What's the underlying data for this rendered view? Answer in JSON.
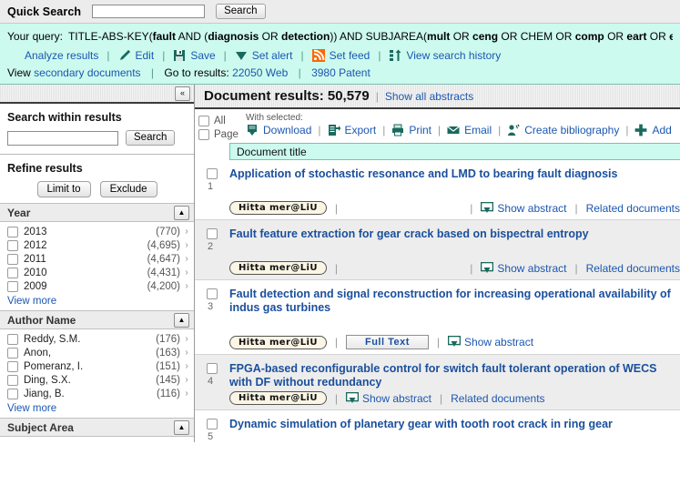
{
  "quick_search": {
    "label": "Quick Search",
    "input_value": "",
    "input_placeholder": "",
    "button_label": "Search"
  },
  "query": {
    "label": "Your query:",
    "parts": [
      {
        "text": "TITLE-ABS-KEY(",
        "bold": false
      },
      {
        "text": "fault",
        "bold": true
      },
      {
        "text": " AND (",
        "bold": false
      },
      {
        "text": "diagnosis",
        "bold": true
      },
      {
        "text": " OR ",
        "bold": false
      },
      {
        "text": "detection",
        "bold": true
      },
      {
        "text": ")) AND SUBJAREA(",
        "bold": false
      },
      {
        "text": "mult",
        "bold": true
      },
      {
        "text": " OR ",
        "bold": false
      },
      {
        "text": "ceng",
        "bold": true
      },
      {
        "text": " OR CHEM OR ",
        "bold": false
      },
      {
        "text": "comp",
        "bold": true
      },
      {
        "text": " OR ",
        "bold": false
      },
      {
        "text": "eart",
        "bold": true
      },
      {
        "text": " OR ",
        "bold": false
      },
      {
        "text": "en",
        "bold": true
      }
    ],
    "actions": [
      {
        "label": "Analyze results",
        "icon": "bar-chart-icon"
      },
      {
        "label": "Edit",
        "icon": "pencil-icon"
      },
      {
        "label": "Save",
        "icon": "floppy-disk-icon"
      },
      {
        "label": "Set alert",
        "icon": "alert-tag-icon"
      },
      {
        "label": "Set feed",
        "icon": "rss-feed-icon"
      },
      {
        "label": "View search history",
        "icon": "search-history-icon"
      }
    ],
    "separator": "|",
    "secondary": {
      "view_label": "View",
      "secondary_link": "secondary documents",
      "goto_label": "Go to results:",
      "web_count": "22050",
      "web_label": "Web",
      "patent_count": "3980",
      "patent_label": "Patent"
    }
  },
  "sidebar": {
    "collapse_icon": "«",
    "search_within": {
      "heading": "Search within results",
      "input_value": "",
      "button_label": "Search"
    },
    "refine": {
      "heading": "Refine results",
      "limit_label": "Limit to",
      "exclude_label": "Exclude"
    },
    "facets": [
      {
        "title": "Year",
        "toggle_icon": "▲",
        "rows": [
          {
            "name": "2013",
            "count": "(770)"
          },
          {
            "name": "2012",
            "count": "(4,695)"
          },
          {
            "name": "2011",
            "count": "(4,647)"
          },
          {
            "name": "2010",
            "count": "(4,431)"
          },
          {
            "name": "2009",
            "count": "(4,200)"
          }
        ],
        "view_more": "View more"
      },
      {
        "title": "Author Name",
        "toggle_icon": "▲",
        "rows": [
          {
            "name": "Reddy, S.M.",
            "count": "(176)"
          },
          {
            "name": "Anon,",
            "count": "(163)"
          },
          {
            "name": "Pomeranz, I.",
            "count": "(151)"
          },
          {
            "name": "Ding, S.X.",
            "count": "(145)"
          },
          {
            "name": "Jiang, B.",
            "count": "(116)"
          }
        ],
        "view_more": "View more"
      },
      {
        "title": "Subject Area",
        "toggle_icon": "▲",
        "rows": [],
        "view_more": ""
      }
    ]
  },
  "results": {
    "header": {
      "title": "Document results: 50,579",
      "divider": "|",
      "show_all_abstracts": "Show all abstracts"
    },
    "select": {
      "all_label": "All",
      "page_label": "Page",
      "with_selected_label": "With selected:",
      "tools": [
        {
          "label": "Download",
          "icon": "download-icon"
        },
        {
          "label": "Export",
          "icon": "export-icon"
        },
        {
          "label": "Print",
          "icon": "printer-icon"
        },
        {
          "label": "Email",
          "icon": "envelope-icon"
        },
        {
          "label": "Create bibliography",
          "icon": "bibliography-icon"
        },
        {
          "label": "Add",
          "icon": "plus-icon"
        }
      ],
      "separator": "|"
    },
    "column_header": "Document title",
    "link_labels": {
      "hitta": "Hitta mer@LiU",
      "full_text": "Full Text",
      "show_abstract": "Show abstract",
      "related_documents": "Related documents",
      "separator": "|"
    },
    "items": [
      {
        "number": "1",
        "title": "Application of stochastic resonance and LMD to bearing fault diagnosis",
        "links": [
          "hitta",
          "gap",
          "show_abstract",
          "related_documents"
        ],
        "shade": "plain",
        "tall": true
      },
      {
        "number": "2",
        "title": "Fault feature extraction for gear crack based on bispectral entropy",
        "links": [
          "hitta",
          "gap",
          "show_abstract",
          "related_documents"
        ],
        "shade": "alt",
        "tall": true
      },
      {
        "number": "3",
        "title": "Fault detection and signal reconstruction for increasing operational availability of indus gas turbines",
        "links": [
          "hitta",
          "full_text",
          "show_abstract"
        ],
        "shade": "plain",
        "tall": true
      },
      {
        "number": "4",
        "title": "FPGA-based reconfigurable control for switch fault tolerant operation of WECS with DF without redundancy",
        "links": [
          "hitta",
          "show_abstract",
          "related_documents"
        ],
        "shade": "alt",
        "tall": false
      },
      {
        "number": "5",
        "title": "Dynamic simulation of planetary gear with tooth root crack in ring gear",
        "links": [],
        "shade": "plain",
        "tall": false
      }
    ]
  }
}
